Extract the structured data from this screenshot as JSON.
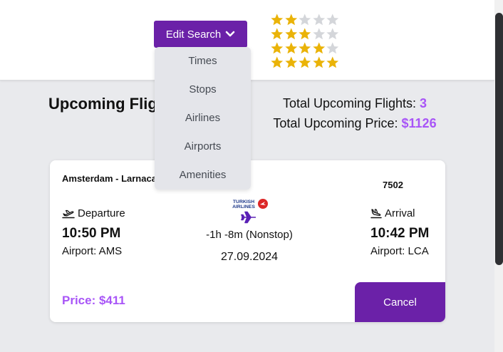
{
  "header": {
    "edit_search_label": "Edit Search",
    "edit_search_icon": "chevron-down-icon",
    "star_ratings": [
      {
        "filled": 2,
        "total": 5
      },
      {
        "filled": 3,
        "total": 5
      },
      {
        "filled": 4,
        "total": 5
      },
      {
        "filled": 5,
        "total": 5
      }
    ],
    "star_color": "#eab308",
    "accent_color": "#6b21a8"
  },
  "dropdown": {
    "items": [
      "Times",
      "Stops",
      "Airlines",
      "Airports",
      "Amenities"
    ]
  },
  "summary": {
    "section_title": "Upcoming Flights",
    "total_flights_label": "Total Upcoming Flights:",
    "total_flights_value": "3",
    "total_price_label": "Total Upcoming Price:",
    "total_price_value": "$1126"
  },
  "flight_card": {
    "route": "Amsterdam - Larnaca",
    "flight_number": "7502",
    "airline_logo_text": [
      "TURKISH",
      "AIRLINES"
    ],
    "departure_label": "Departure",
    "departure_time": "10:50 PM",
    "departure_airport": "Airport: AMS",
    "arrival_label": "Arrival",
    "arrival_time": "10:42 PM",
    "arrival_airport": "Airport: LCA",
    "duration": "-1h -8m (Nonstop)",
    "date": "27.09.2024",
    "price": "Price: $411",
    "cancel_label": "Cancel"
  }
}
